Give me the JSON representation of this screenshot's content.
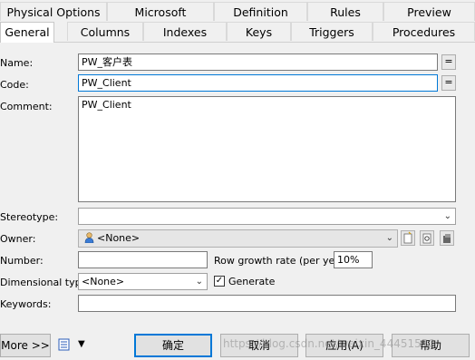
{
  "tabs_row1": [
    "Physical Options",
    "Microsoft",
    "Definition",
    "Rules",
    "Preview"
  ],
  "tabs_row2": [
    "General",
    "Columns",
    "Indexes",
    "Keys",
    "Triggers",
    "Procedures"
  ],
  "form": {
    "name_label": "Name:",
    "name_value": "PW_客户表",
    "code_label": "Code:",
    "code_value": "PW_Client",
    "comment_label": "Comment:",
    "comment_value": "PW_Client",
    "stereotype_label": "Stereotype:",
    "stereotype_value": "",
    "owner_label": "Owner:",
    "owner_value": "<None>",
    "number_label": "Number:",
    "number_value": "",
    "row_growth_label": "Row growth rate (per year):",
    "row_growth_value": "10%",
    "dimensional_label": "Dimensional type:",
    "dimensional_value": "<None>",
    "generate_label": "Generate",
    "generate_checked": true,
    "keywords_label": "Keywords:",
    "keywords_value": "",
    "equals_symbol": "="
  },
  "footer": {
    "more_label": "More >>",
    "ok_label": "确定",
    "cancel_label": "取消",
    "apply_label": "应用(A)",
    "help_label": "帮助"
  },
  "watermark": "https://blog.csdn.net/weixin_44451580"
}
